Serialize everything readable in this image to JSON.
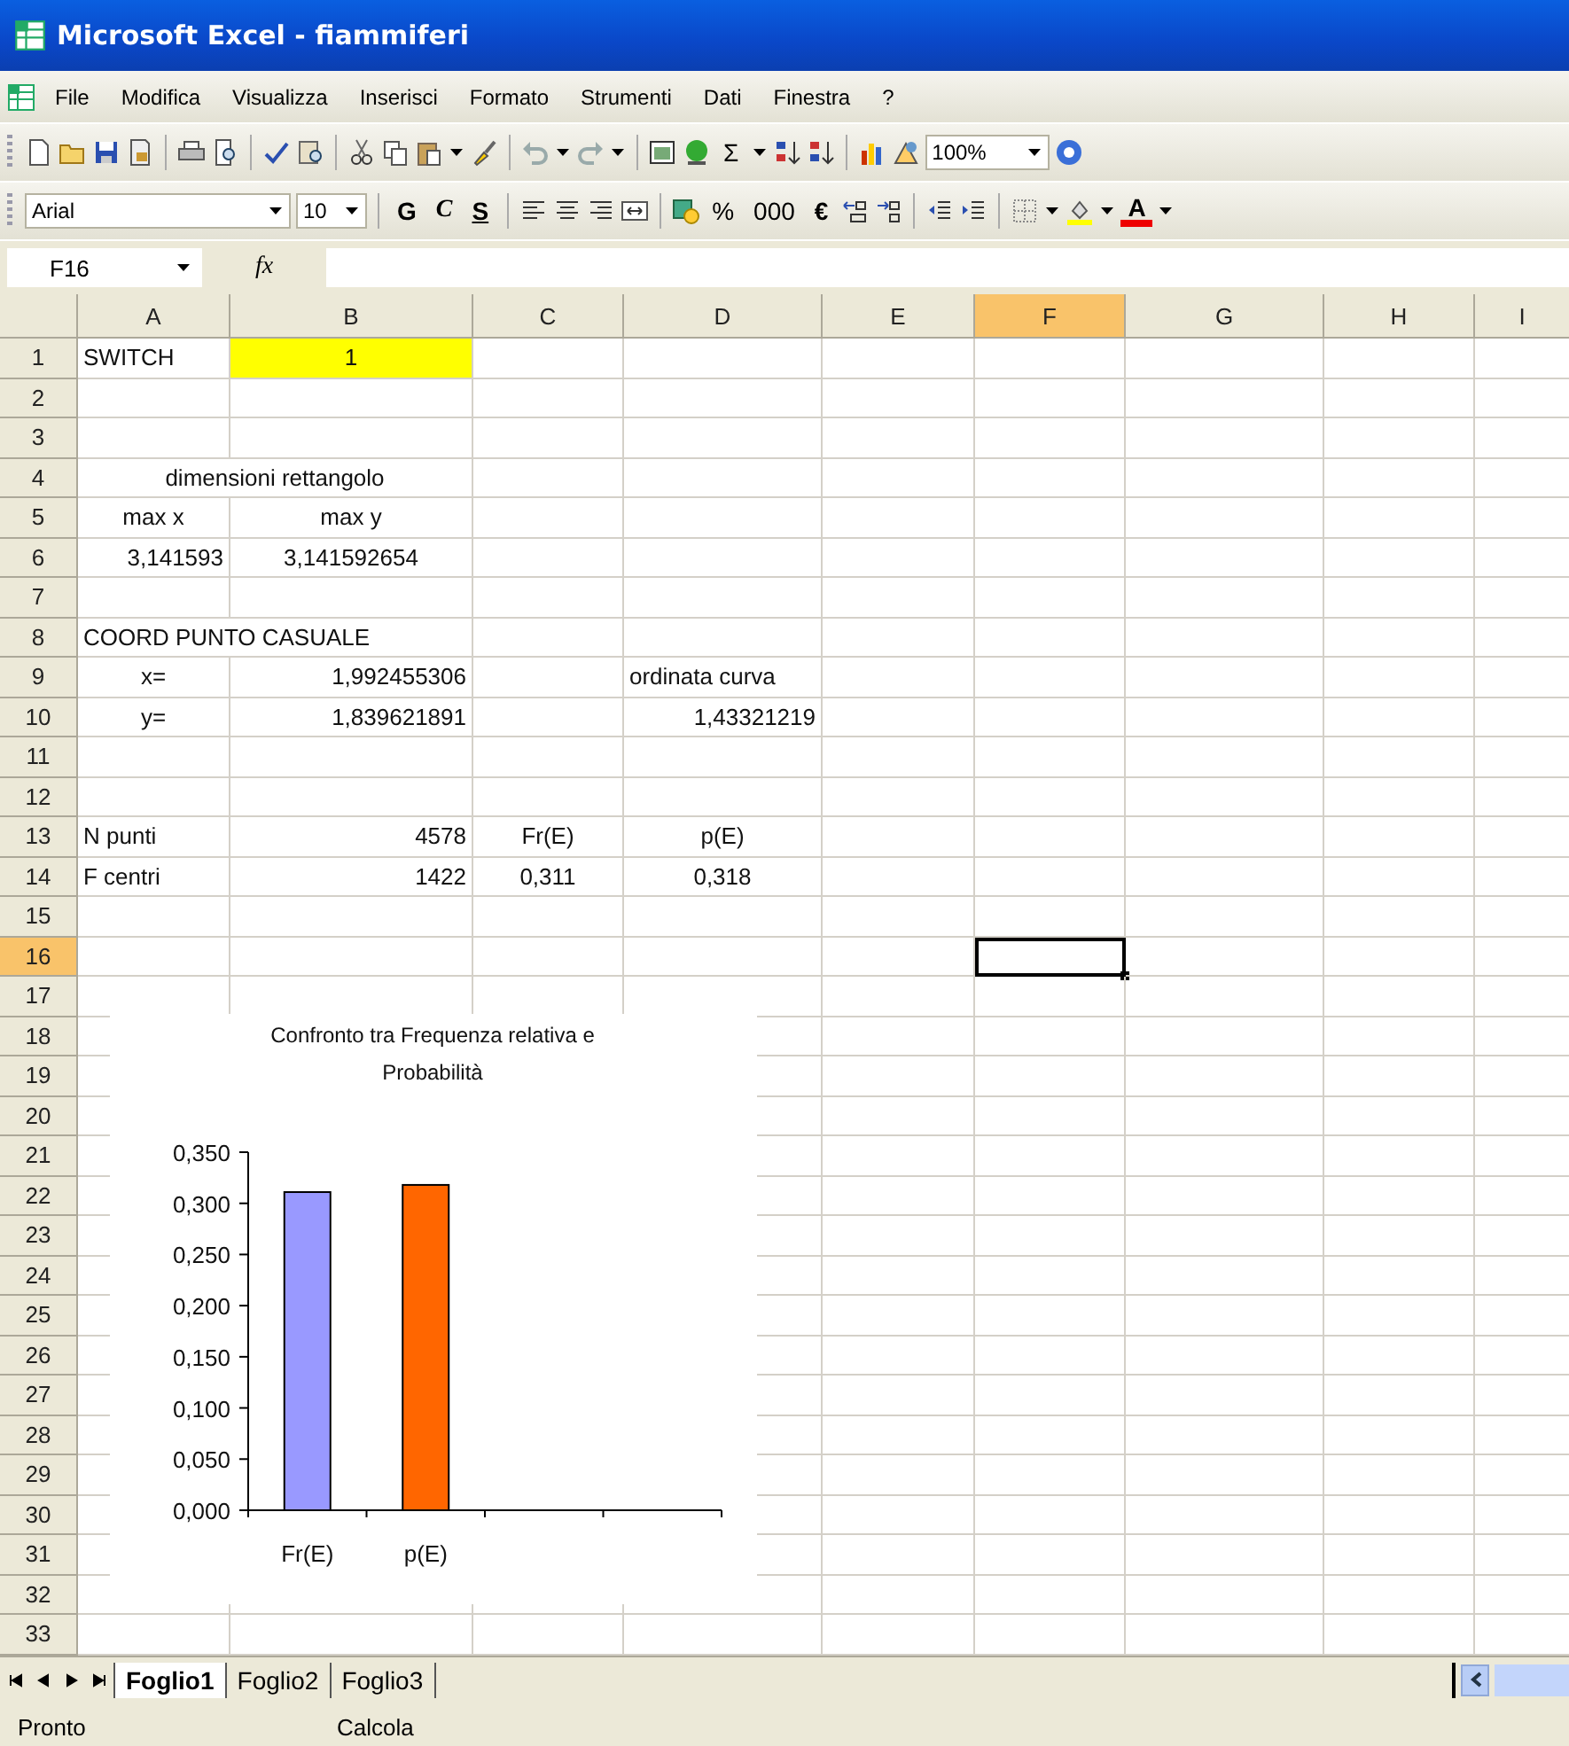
{
  "window": {
    "title": "Microsoft Excel - fiammiferi"
  },
  "menu": [
    "File",
    "Modifica",
    "Visualizza",
    "Inserisci",
    "Formato",
    "Strumenti",
    "Dati",
    "Finestra",
    "?"
  ],
  "standard_toolbar": [
    {
      "kind": "icon"
    },
    {
      "kind": "icon"
    },
    {
      "kind": "icon"
    },
    {
      "kind": "icon"
    },
    {
      "kind": "sep"
    },
    {
      "kind": "icon"
    },
    {
      "kind": "icon"
    },
    {
      "kind": "sep"
    },
    {
      "kind": "icon"
    },
    {
      "kind": "icon"
    },
    {
      "kind": "sep"
    },
    {
      "kind": "icon"
    },
    {
      "kind": "icon"
    },
    {
      "kind": "icon"
    },
    {
      "kind": "dd"
    },
    {
      "kind": "icon"
    },
    {
      "kind": "sep"
    },
    {
      "kind": "icon"
    },
    {
      "kind": "dd"
    },
    {
      "kind": "icon"
    },
    {
      "kind": "dd"
    },
    {
      "kind": "sep"
    },
    {
      "kind": "icon"
    },
    {
      "kind": "icon"
    },
    {
      "kind": "text",
      "label": "Σ"
    },
    {
      "kind": "dd"
    },
    {
      "kind": "icon"
    },
    {
      "kind": "icon"
    },
    {
      "kind": "sep"
    },
    {
      "kind": "icon"
    },
    {
      "kind": "icon"
    },
    {
      "kind": "combo",
      "value": "100%"
    },
    {
      "kind": "icon"
    }
  ],
  "formatting_toolbar": [
    {
      "kind": "combo",
      "value": "Arial"
    },
    {
      "kind": "combo",
      "value": "10"
    },
    {
      "kind": "sep"
    },
    {
      "kind": "text",
      "label": "G"
    },
    {
      "kind": "text",
      "label": "C"
    },
    {
      "kind": "text",
      "label": "S"
    },
    {
      "kind": "sep"
    },
    {
      "kind": "icon"
    },
    {
      "kind": "icon"
    },
    {
      "kind": "icon"
    },
    {
      "kind": "icon"
    },
    {
      "kind": "sep"
    },
    {
      "kind": "icon"
    },
    {
      "kind": "text",
      "label": "%"
    },
    {
      "kind": "text",
      "label": "000"
    },
    {
      "kind": "text",
      "label": "€"
    },
    {
      "kind": "icon"
    },
    {
      "kind": "icon"
    },
    {
      "kind": "sep"
    },
    {
      "kind": "icon"
    },
    {
      "kind": "icon"
    },
    {
      "kind": "sep"
    },
    {
      "kind": "icon"
    },
    {
      "kind": "dd"
    },
    {
      "kind": "icon"
    },
    {
      "kind": "dd"
    },
    {
      "kind": "text",
      "label": "A"
    },
    {
      "kind": "dd"
    }
  ],
  "formula_bar": {
    "name_box": "F16",
    "fx": "fx"
  },
  "columns": [
    {
      "label": "A",
      "selected": false
    },
    {
      "label": "B",
      "selected": false
    },
    {
      "label": "C",
      "selected": false
    },
    {
      "label": "D",
      "selected": false
    },
    {
      "label": "E",
      "selected": false
    },
    {
      "label": "F",
      "selected": true
    },
    {
      "label": "G",
      "selected": false
    },
    {
      "label": "H",
      "selected": false
    },
    {
      "label": "I",
      "selected": false
    }
  ],
  "rows": [
    {
      "number": "1",
      "selected": false,
      "cells": [
        {
          "kind": "text",
          "text": "SWITCH"
        },
        {
          "kind": "centered",
          "text": "1",
          "color": "#ffff00"
        }
      ]
    },
    {
      "number": "2",
      "selected": false,
      "cells": []
    },
    {
      "number": "3",
      "selected": false,
      "cells": []
    },
    {
      "number": "4",
      "selected": false,
      "cells": [
        {
          "kind": "merged",
          "text": "dimensioni rettangolo"
        }
      ]
    },
    {
      "number": "5",
      "selected": false,
      "cells": [
        {
          "kind": "centered",
          "text": "max x"
        },
        {
          "kind": "centered",
          "text": "max y"
        }
      ]
    },
    {
      "number": "6",
      "selected": false,
      "cells": [
        {
          "kind": "number",
          "text": "3,141593"
        },
        {
          "kind": "centered",
          "text": "3,141592654"
        }
      ]
    },
    {
      "number": "7",
      "selected": false,
      "cells": []
    },
    {
      "number": "8",
      "selected": false,
      "cells": [
        {
          "kind": "overflow",
          "text": "COORD PUNTO CASUALE"
        }
      ]
    },
    {
      "number": "9",
      "selected": false,
      "cells": [
        {
          "kind": "centered",
          "text": "x="
        },
        {
          "kind": "number",
          "text": "1,992455306"
        },
        {
          "kind": "blank"
        },
        {
          "kind": "text",
          "text": "ordinata curva"
        }
      ]
    },
    {
      "number": "10",
      "selected": false,
      "cells": [
        {
          "kind": "centered",
          "text": "y="
        },
        {
          "kind": "number",
          "text": "1,839621891"
        },
        {
          "kind": "blank"
        },
        {
          "kind": "number",
          "text": "1,43321219"
        }
      ]
    },
    {
      "number": "11",
      "selected": false,
      "cells": []
    },
    {
      "number": "12",
      "selected": false,
      "cells": []
    },
    {
      "number": "13",
      "selected": false,
      "cells": [
        {
          "kind": "text",
          "text": "N punti"
        },
        {
          "kind": "number",
          "text": "4578"
        },
        {
          "kind": "centered",
          "text": "Fr(E)"
        },
        {
          "kind": "centered",
          "text": "p(E)"
        }
      ]
    },
    {
      "number": "14",
      "selected": false,
      "cells": [
        {
          "kind": "text",
          "text": "F centri"
        },
        {
          "kind": "number",
          "text": "1422"
        },
        {
          "kind": "centered",
          "text": "0,311"
        },
        {
          "kind": "centered",
          "text": "0,318"
        }
      ]
    },
    {
      "number": "15",
      "selected": false,
      "cells": []
    },
    {
      "number": "16",
      "selected": true,
      "cells": []
    },
    {
      "number": "17",
      "selected": false,
      "cells": []
    },
    {
      "number": "18",
      "selected": false,
      "cells": []
    },
    {
      "number": "19",
      "selected": false,
      "cells": []
    },
    {
      "number": "20",
      "selected": false,
      "cells": []
    },
    {
      "number": "21",
      "selected": false,
      "cells": []
    },
    {
      "number": "22",
      "selected": false,
      "cells": []
    },
    {
      "number": "23",
      "selected": false,
      "cells": []
    },
    {
      "number": "24",
      "selected": false,
      "cells": []
    },
    {
      "number": "25",
      "selected": false,
      "cells": []
    },
    {
      "number": "26",
      "selected": false,
      "cells": []
    },
    {
      "number": "27",
      "selected": false,
      "cells": []
    },
    {
      "number": "28",
      "selected": false,
      "cells": []
    },
    {
      "number": "29",
      "selected": false,
      "cells": []
    },
    {
      "number": "30",
      "selected": false,
      "cells": []
    },
    {
      "number": "31",
      "selected": false,
      "cells": []
    },
    {
      "number": "32",
      "selected": false,
      "cells": []
    },
    {
      "number": "33",
      "selected": false,
      "cells": []
    }
  ],
  "chart": {
    "chart_data": {
      "type": "bar",
      "title": "Confronto tra Frequenza relativa e Probabilità",
      "categories": [
        "Fr(E)",
        "p(E)"
      ],
      "stacked": true,
      "series": [
        {
          "color": "#9999ff",
          "values": [
            0.311,
            null
          ]
        },
        {
          "color": "#ff6600",
          "values": [
            null,
            0.318
          ]
        }
      ],
      "ylim": [
        0,
        0.35
      ],
      "yticks": [
        {
          "value": 0,
          "label": "0,000"
        },
        {
          "value": 0.05,
          "label": "0,050"
        },
        {
          "value": 0.1,
          "label": "0,100"
        },
        {
          "value": 0.15,
          "label": "0,150"
        },
        {
          "value": 0.2,
          "label": "0,200"
        },
        {
          "value": 0.25,
          "label": "0,250"
        },
        {
          "value": 0.3,
          "label": "0,300"
        },
        {
          "value": 0.35,
          "label": "0,350"
        }
      ]
    }
  },
  "sheet_tabs": [
    {
      "label": "Foglio1",
      "selected": true
    },
    {
      "label": "Foglio2",
      "selected": false
    },
    {
      "label": "Foglio3",
      "selected": false
    }
  ],
  "status_bar": [
    "Pronto",
    "Calcola"
  ]
}
